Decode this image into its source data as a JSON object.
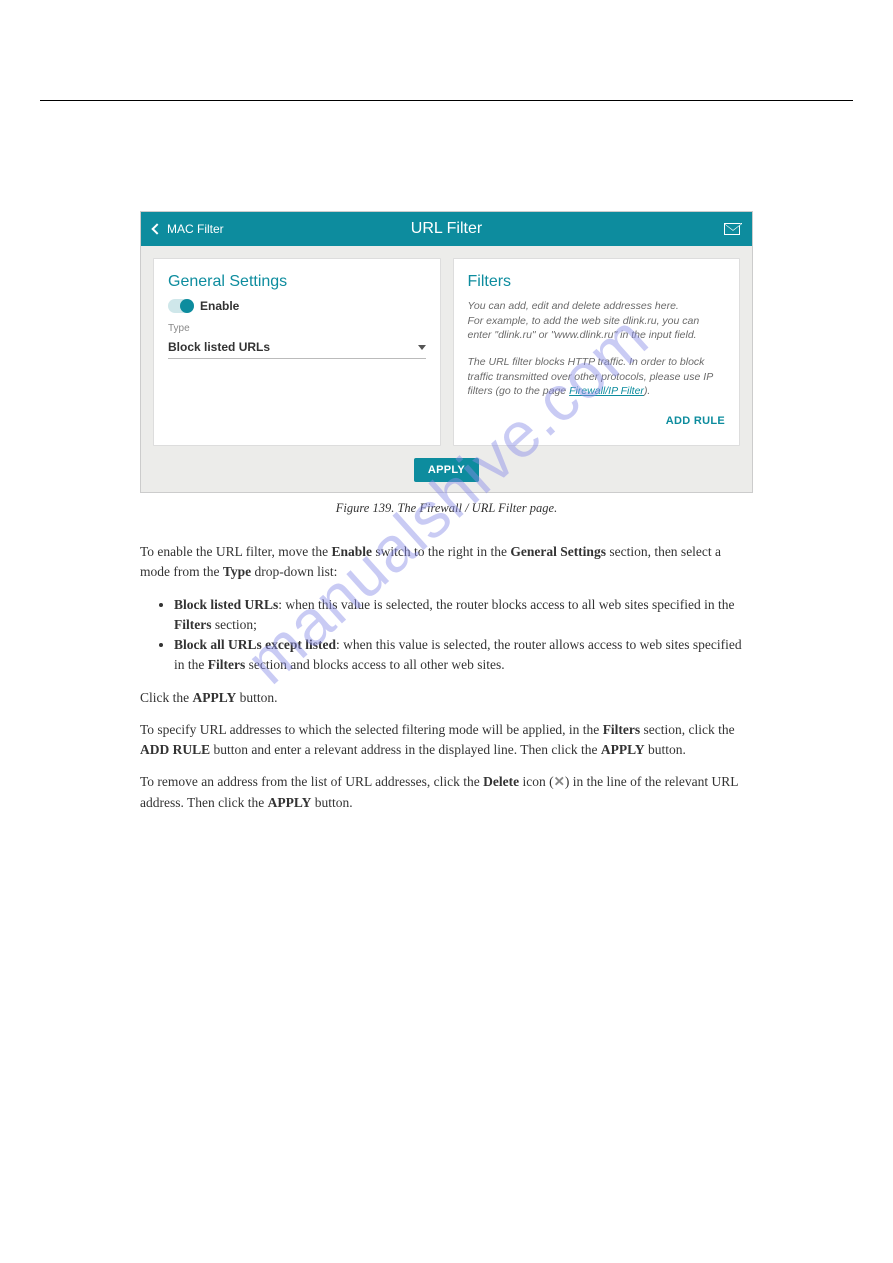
{
  "header": {
    "back_label": "MAC Filter",
    "title": "URL Filter"
  },
  "general": {
    "title": "General Settings",
    "enable_label": "Enable",
    "type_label": "Type",
    "type_value": "Block listed URLs"
  },
  "filters": {
    "title": "Filters",
    "help_line1": "You can add, edit and delete addresses here.",
    "help_line2": "For example, to add the web site dlink.ru, you can enter \"dlink.ru\" or \"www.dlink.ru\" in the input field.",
    "help_line3a": "The URL filter blocks HTTP traffic. In order to block traffic transmitted over other protocols, please use IP filters (go to the page ",
    "help_link": "Firewall/IP Filter",
    "help_line3b": ").",
    "add_rule": "ADD RULE"
  },
  "apply_label": "APPLY",
  "caption": "Figure 139. The Firewall / URL Filter page.",
  "para1_a": "To enable the URL filter, move the ",
  "para1_b": "Enable",
  "para1_c": " switch to the right in the ",
  "para1_d": "General Settings",
  "para1_e": " section, then select a mode from the ",
  "para1_f": "Type",
  "para1_g": " drop-down list:",
  "bullets": {
    "b1a": "Block listed URLs",
    "b1b": ": when this value is selected, the router blocks access to all web sites specified in the ",
    "b1c": "Filters",
    "b1d": " section;",
    "b2a": "Block all URLs except listed",
    "b2b": ": when this value is selected, the router allows access to web sites specified in the ",
    "b2c": "Filters",
    "b2d": " section and blocks access to all other web sites."
  },
  "para2_a": "Click the ",
  "para2_b": "APPLY",
  "para2_c": " button.",
  "para3_a": "To specify URL addresses to which the selected filtering mode will be applied, in the ",
  "para3_b": "Filters",
  "para3_c": " section, click the ",
  "para3_d": "ADD RULE",
  "para3_e": " button and enter a relevant address in the displayed line. Then click the ",
  "para3_f": "APPLY",
  "para3_g": " button.",
  "para4_a": "To remove an address from the list of URL addresses, click the ",
  "para4_b": "Delete",
  "para4_c": " icon (",
  "para4_x": "✕",
  "para4_d": ") in the line of the relevant URL address. Then click the ",
  "para4_e": "APPLY",
  "para4_f": " button.",
  "watermark": "manualshive.com"
}
